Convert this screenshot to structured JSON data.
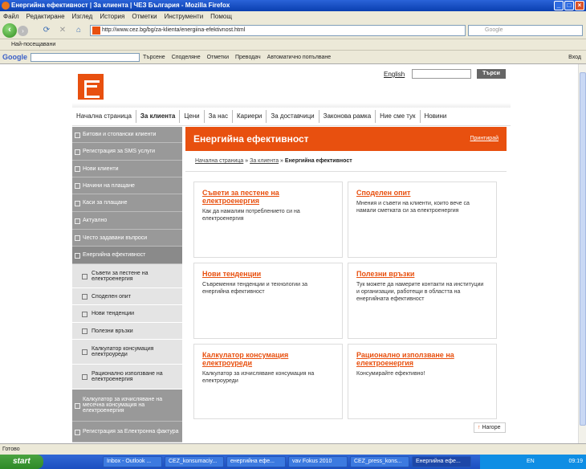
{
  "window": {
    "title": "Енергийна ефективност | За клиента | ЧЕЗ България - Mozilla Firefox"
  },
  "menu": [
    "Файл",
    "Редактиране",
    "Изглед",
    "История",
    "Отметки",
    "Инструменти",
    "Помощ"
  ],
  "address": {
    "url": "http://www.cez.bg/bg/za-klienta/energiina-efektivnost.html"
  },
  "search": {
    "placeholder": "Google"
  },
  "bookmarks": {
    "label": "Най-посещавани"
  },
  "googlebar": {
    "logo": "Google",
    "search": "Търсене",
    "share": "Споделяне",
    "bookmarks": "Отметки",
    "translate": "Преводач",
    "autofill": "Автоматично попълване",
    "login": "Вход"
  },
  "site": {
    "lang": "English",
    "search_button": "Търси",
    "nav": [
      "Начална страница",
      "За клиента",
      "Цени",
      "За нас",
      "Кариери",
      "За доставчици",
      "Законова рамка",
      "Ние сме тук",
      "Новини"
    ],
    "nav_current": 1,
    "sidebar": [
      {
        "label": "Битови и стопански клиенти",
        "sub": false,
        "h": 20
      },
      {
        "label": "Регистрация за SMS услуги",
        "sub": false,
        "h": 22
      },
      {
        "label": "Нови клиенти",
        "sub": false,
        "h": 21
      },
      {
        "label": "Начини на плащане",
        "sub": false,
        "h": 21
      },
      {
        "label": "Каси за плащане",
        "sub": false,
        "h": 22
      },
      {
        "label": "Актуално",
        "sub": false,
        "h": 22
      },
      {
        "label": "Често задавани въпроси",
        "sub": false,
        "h": 21
      },
      {
        "label": "Енергийна ефективност",
        "sub": false,
        "h": 22,
        "cur": true
      },
      {
        "label": "Съвети за пестене на електроенергия",
        "sub": true,
        "h": 30
      },
      {
        "label": "Споделен опит",
        "sub": true,
        "h": 21
      },
      {
        "label": "Нови тенденции",
        "sub": true,
        "h": 22
      },
      {
        "label": "Полезни връзки",
        "sub": true,
        "h": 21
      },
      {
        "label": "Калкулатор консумация електроуреди",
        "sub": true,
        "h": 31
      },
      {
        "label": "Рационално използване на електроенергия",
        "sub": true,
        "h": 31
      },
      {
        "label": "Калкулатор за изчисляване на месечна консумация на електроенергия",
        "sub": false,
        "h": 40
      },
      {
        "label": "Регистрация за Електронна фактура",
        "sub": false,
        "h": 26
      }
    ],
    "page_title": "Енергийна ефективност",
    "print": "Принтирай",
    "breadcrumb": {
      "home": "Начална страница",
      "section": "За клиента",
      "current": "Енергийна ефективност",
      "sep": "»"
    },
    "cards": [
      {
        "title": "Съвети за пестене на електроенергия",
        "desc": "Как да намалим потреблението си на електроенергия"
      },
      {
        "title": "Споделен опит",
        "desc": "Мнения и съвети на клиенти, които вече са намали сметката си за електроенергия"
      },
      {
        "title": "Нови тенденции",
        "desc": "Съвременни тенденции и технологии за енергийна ефективност"
      },
      {
        "title": "Полезни връзки",
        "desc": "Тук можете да намерите контакти на институции и организации, работещи в областта на енергийната ефективност"
      },
      {
        "title": "Калкулатор консумация електроуреди",
        "desc": "Калкулатор за изчисляване консумация на електроуреди"
      },
      {
        "title": "Рационално използване на електроенергия",
        "desc": "Консумирайте ефективно!"
      }
    ],
    "back_to_top": "Нагоре"
  },
  "status": "Готово",
  "taskbar": {
    "start": "start",
    "tasks": [
      "Inbox - Outlook ...",
      "CEZ_konsumaciy...",
      "енергийна ефе...",
      "vav Fokus 2010",
      "CEZ_press_kons...",
      "Енергийна ефе..."
    ],
    "active": 5,
    "lang": "EN",
    "time": "09:19"
  }
}
